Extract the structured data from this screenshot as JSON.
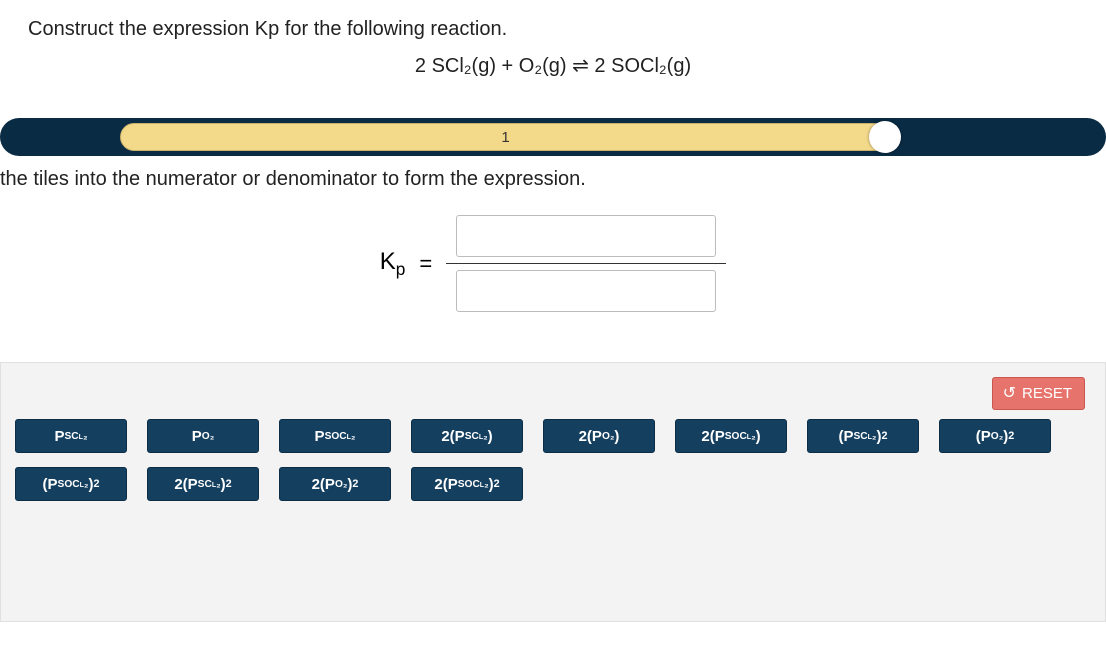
{
  "prompt": "Construct the expression Kp for the following reaction.",
  "reaction_html": "2 SCl₂(g) + O₂(g) ⇌ 2 SOCl₂(g)",
  "progress": {
    "label": "1"
  },
  "instruction": "the tiles into the numerator or denominator to form the expression.",
  "kp": {
    "label": "K",
    "subscript": "p",
    "equals": "="
  },
  "reset": {
    "label": "RESET"
  },
  "tiles_row1": [
    {
      "pre": "P",
      "sub": "SCl₂",
      "sup": ""
    },
    {
      "pre": "P",
      "sub": "O₂",
      "sup": ""
    },
    {
      "pre": "P",
      "sub": "SOCl₂",
      "sup": ""
    },
    {
      "pre": "2(P",
      "sub": "SCl₂",
      "sup": "",
      "post": ")"
    },
    {
      "pre": "2(P",
      "sub": "O₂",
      "sup": "",
      "post": ")"
    },
    {
      "pre": "2(P",
      "sub": "SOCl₂",
      "sup": "",
      "post": ")"
    },
    {
      "pre": "(P",
      "sub": "SCl₂",
      "sup": "2",
      "post": ")"
    },
    {
      "pre": "(P",
      "sub": "O₂",
      "sup": "2",
      "post": ")"
    }
  ],
  "tiles_row2": [
    {
      "pre": "(P",
      "sub": "SOCl₂",
      "sup": "2",
      "post": ")"
    },
    {
      "pre": "2(P",
      "sub": "SCl₂",
      "sup": "2",
      "post": ")"
    },
    {
      "pre": "2(P",
      "sub": "O₂",
      "sup": "2",
      "post": ")"
    },
    {
      "pre": "2(P",
      "sub": "SOCl₂",
      "sup": "2",
      "post": ")"
    }
  ]
}
